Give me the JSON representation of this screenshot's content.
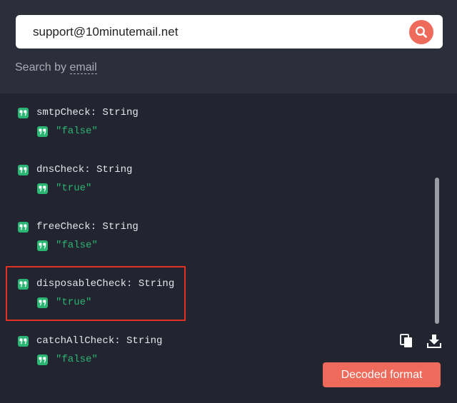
{
  "search": {
    "value": "support@10minutemail.net",
    "by_label": "Search by",
    "by_link": "email"
  },
  "fields": [
    {
      "key": "smtpCheck: String",
      "value": "\"false\""
    },
    {
      "key": "dnsCheck: String",
      "value": "\"true\""
    },
    {
      "key": "freeCheck: String",
      "value": "\"false\""
    },
    {
      "key": "disposableCheck: String",
      "value": "\"true\""
    },
    {
      "key": "catchAllCheck: String",
      "value": "\"false\""
    }
  ],
  "actions": {
    "decoded_format_label": "Decoded format"
  },
  "icons": {
    "search": "search-icon",
    "quote": "quote-icon",
    "copy": "copy-icon",
    "download": "download-icon"
  },
  "colors": {
    "accent": "#ee6a5b",
    "string_green": "#2bb673",
    "highlight_red": "#e1321f",
    "background": "#22242f",
    "header": "#2c2e39"
  }
}
